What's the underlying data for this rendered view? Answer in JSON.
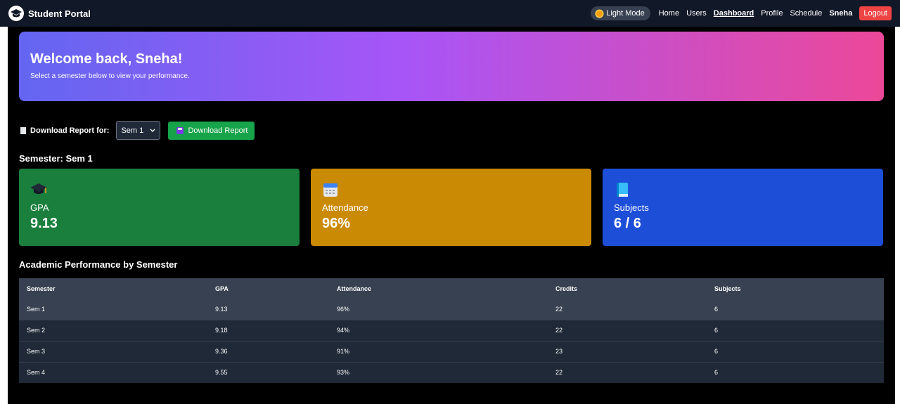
{
  "nav": {
    "brand": "Student Portal",
    "theme_toggle": "Light Mode",
    "links": [
      "Home",
      "Users",
      "Dashboard",
      "Profile",
      "Schedule"
    ],
    "active_link": "Dashboard",
    "user": "Sneha",
    "logout": "Logout"
  },
  "hero": {
    "title": "Welcome back, Sneha!",
    "subtitle": "Select a semester below to view your performance."
  },
  "report": {
    "label": "Download Report for:",
    "selected": "Sem 1",
    "button": "Download Report"
  },
  "semester_heading": "Semester: Sem 1",
  "cards": {
    "gpa": {
      "icon": "graduation-cap-icon",
      "label": "GPA",
      "value": "9.13",
      "color": "#1a7f3c"
    },
    "attendance": {
      "icon": "calendar-icon",
      "label": "Attendance",
      "value": "96%",
      "color": "#ca8a04"
    },
    "subjects": {
      "icon": "book-icon",
      "label": "Subjects",
      "value": "6 / 6",
      "color": "#1d4ed8"
    }
  },
  "performance": {
    "heading": "Academic Performance by Semester",
    "columns": [
      "Semester",
      "GPA",
      "Attendance",
      "Credits",
      "Subjects"
    ],
    "rows": [
      [
        "Sem 1",
        "9.13",
        "96%",
        "22",
        "6"
      ],
      [
        "Sem 2",
        "9.18",
        "94%",
        "22",
        "6"
      ],
      [
        "Sem 3",
        "9.36",
        "91%",
        "23",
        "6"
      ],
      [
        "Sem 4",
        "9.55",
        "93%",
        "22",
        "6"
      ]
    ]
  },
  "colors": {
    "navbar": "#111827",
    "logout": "#ef4444",
    "download": "#16a34a"
  }
}
